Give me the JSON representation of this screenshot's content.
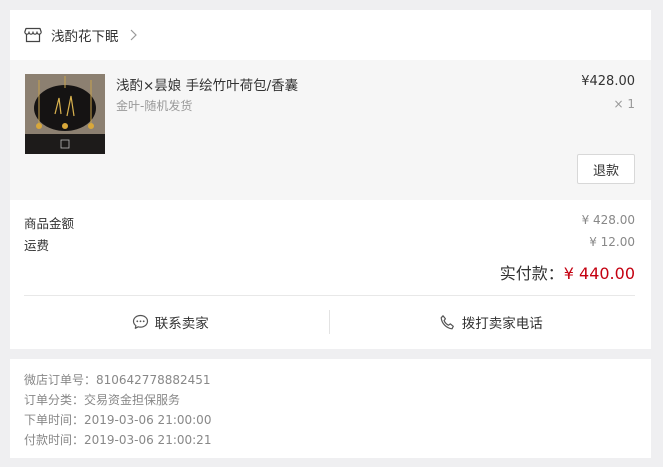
{
  "shop": {
    "name": "浅酌花下眠"
  },
  "item": {
    "title": "浅酌×昙娘 手绘竹叶荷包/香囊",
    "sku": "金叶-随机发货",
    "price": "¥428.00",
    "qty": "× 1",
    "refund_label": "退款"
  },
  "summary": {
    "goods_label": "商品金额",
    "goods_value": "¥ 428.00",
    "shipping_label": "运费",
    "shipping_value": "¥ 12.00",
    "paid_label": "实付款：",
    "paid_value": "¥ 440.00"
  },
  "actions": {
    "contact_label": "联系卖家",
    "call_label": "拨打卖家电话"
  },
  "info": {
    "order_no": "微店订单号：810642778882451",
    "order_type": "订单分类：交易资金担保服务",
    "order_time": "下单时间：2019-03-06 21:00:00",
    "pay_time": "付款时间：2019-03-06 21:00:21"
  },
  "colors": {
    "accent": "#c40010",
    "background": "#efeff1",
    "item_bg": "#f6f6f6"
  },
  "icons": {
    "shop": "store-icon",
    "chevron": "chevron-right-icon",
    "chat": "chat-bubble-icon",
    "phone": "phone-icon"
  }
}
